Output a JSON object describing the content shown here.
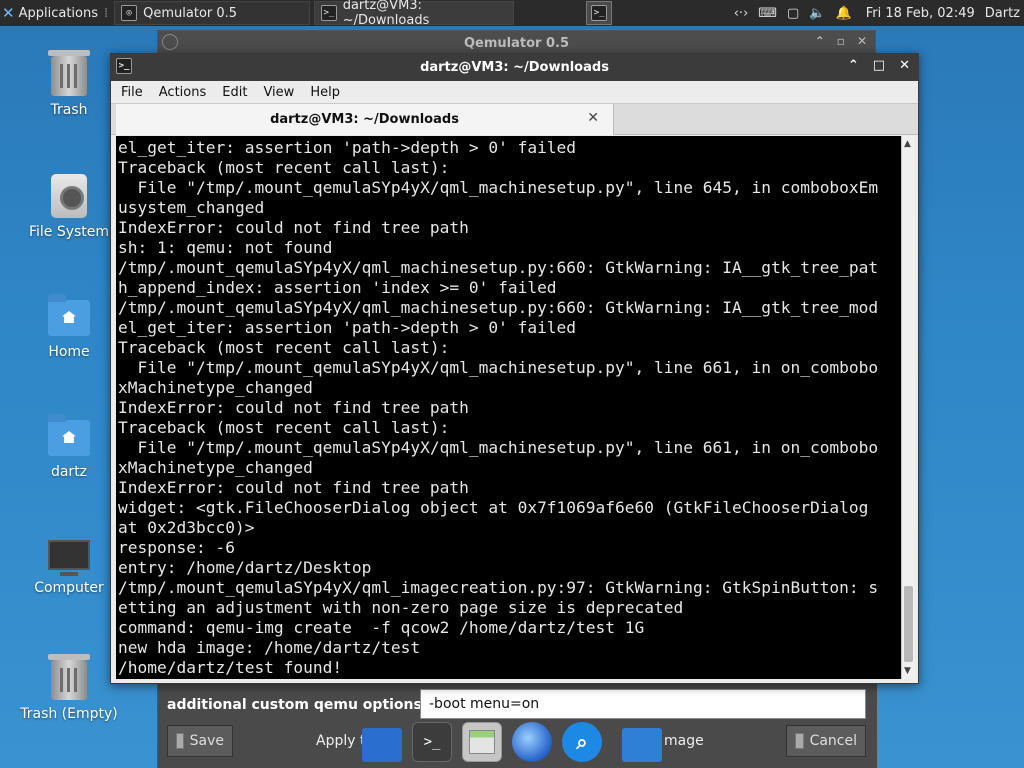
{
  "top_panel": {
    "applications_label": "Applications",
    "tasks": [
      {
        "label": "Qemulator 0.5"
      },
      {
        "label": "dartz@VM3: ~/Downloads"
      }
    ],
    "clock": "Fri 18 Feb, 02:49",
    "user": "Dartz"
  },
  "desktop": {
    "icons": [
      {
        "label": "Trash"
      },
      {
        "label": "File System"
      },
      {
        "label": "Home"
      },
      {
        "label": "dartz"
      },
      {
        "label": "Computer"
      },
      {
        "label": "Trash (Empty)"
      }
    ]
  },
  "qemulator_window": {
    "title": "Qemulator 0.5",
    "options_label": "additional custom qemu options",
    "options_value": "-boot menu=on",
    "save_label": "Save",
    "apply_label": "Apply t",
    "image_label": "mage",
    "cancel_label": "Cancel"
  },
  "terminal_window": {
    "title": "dartz@VM3: ~/Downloads",
    "menu": [
      "File",
      "Actions",
      "Edit",
      "View",
      "Help"
    ],
    "tab_label": "dartz@VM3: ~/Downloads",
    "lines": [
      "el_get_iter: assertion 'path->depth > 0' failed",
      "Traceback (most recent call last):",
      "  File \"/tmp/.mount_qemulaSYp4yX/qml_machinesetup.py\", line 645, in comboboxEm",
      "usystem_changed",
      "IndexError: could not find tree path",
      "sh: 1: qemu: not found",
      "/tmp/.mount_qemulaSYp4yX/qml_machinesetup.py:660: GtkWarning: IA__gtk_tree_pat",
      "h_append_index: assertion 'index >= 0' failed",
      "/tmp/.mount_qemulaSYp4yX/qml_machinesetup.py:660: GtkWarning: IA__gtk_tree_mod",
      "el_get_iter: assertion 'path->depth > 0' failed",
      "Traceback (most recent call last):",
      "  File \"/tmp/.mount_qemulaSYp4yX/qml_machinesetup.py\", line 661, in on_combobo",
      "xMachinetype_changed",
      "IndexError: could not find tree path",
      "Traceback (most recent call last):",
      "  File \"/tmp/.mount_qemulaSYp4yX/qml_machinesetup.py\", line 661, in on_combobo",
      "xMachinetype_changed",
      "IndexError: could not find tree path",
      "widget: <gtk.FileChooserDialog object at 0x7f1069af6e60 (GtkFileChooserDialog",
      "at 0x2d3bcc0)>",
      "response: -6",
      "entry: /home/dartz/Desktop",
      "/tmp/.mount_qemulaSYp4yX/qml_imagecreation.py:97: GtkWarning: GtkSpinButton: s",
      "etting an adjustment with non-zero page size is deprecated",
      "command: qemu-img create  -f qcow2 /home/dartz/test 1G",
      "new hda image: /home/dartz/test",
      "/home/dartz/test found!"
    ]
  }
}
